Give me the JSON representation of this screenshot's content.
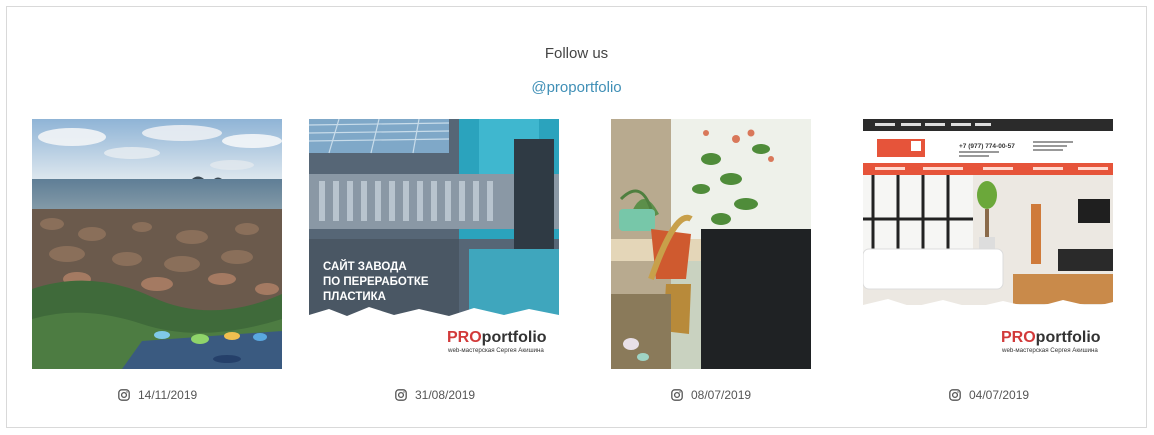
{
  "follow": {
    "title": "Follow us",
    "handle": "@proportfolio"
  },
  "colors": {
    "link": "#3f8fb6",
    "brand_red": "#d23a3a",
    "site_orange": "#e6543a"
  },
  "posts": [
    {
      "date": "14/11/2019",
      "image": "rocky-seashore-photo"
    },
    {
      "date": "31/08/2019",
      "image": "plastic-factory-site-promo",
      "overlay_lines": [
        "САЙТ ЗАВОДА",
        "ПО ПЕРЕРАБОТКЕ",
        "ПЛАСТИКА"
      ],
      "brand_pro": "PRO",
      "brand_rest": "portfolio",
      "brand_sub": "web-мастерская Сергея Акишина"
    },
    {
      "date": "08/07/2019",
      "image": "houseplants-window-photo"
    },
    {
      "date": "04/07/2019",
      "image": "renovation-site-promo",
      "site_phone": "+7 (977) 774-00-57",
      "brand_pro": "PRO",
      "brand_rest": "portfolio",
      "brand_sub": "web-мастерская Сергея Акишина"
    }
  ]
}
